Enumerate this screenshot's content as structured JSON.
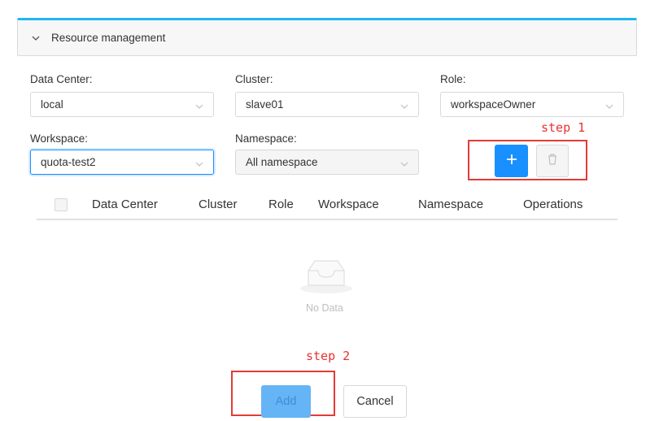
{
  "panel": {
    "title": "Resource management",
    "icon": "chevron-down-icon"
  },
  "form": {
    "data_center": {
      "label": "Data Center:",
      "value": "local"
    },
    "cluster": {
      "label": "Cluster:",
      "value": "slave01"
    },
    "role": {
      "label": "Role:",
      "value": "workspaceOwner"
    },
    "workspace": {
      "label": "Workspace:",
      "value": "quota-test2"
    },
    "namespace": {
      "label": "Namespace:",
      "value": "All namespace"
    }
  },
  "actions": {
    "add_icon": "plus-icon",
    "delete_icon": "trash-icon"
  },
  "annotations": {
    "step1": "step 1",
    "step2": "step 2",
    "color": "#e23b36"
  },
  "table": {
    "columns": [
      "Data Center",
      "Cluster",
      "Role",
      "Workspace",
      "Namespace",
      "Operations"
    ],
    "empty_text": "No Data"
  },
  "footer": {
    "add_label": "Add",
    "cancel_label": "Cancel"
  },
  "colors": {
    "primary": "#1890ff",
    "accent_border": "#1fb6f0"
  }
}
